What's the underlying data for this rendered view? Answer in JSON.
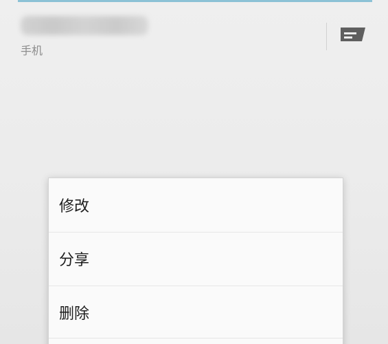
{
  "contact": {
    "number_hidden": true,
    "phone_type": "手机"
  },
  "actions": {
    "message_icon": "message-icon"
  },
  "context_menu": {
    "items": [
      {
        "label": "修改"
      },
      {
        "label": "分享"
      },
      {
        "label": "删除"
      }
    ]
  },
  "colors": {
    "accent_strip": "#8cc2d6",
    "icon": "#5f5f5f",
    "menu_text": "#1e1e1e",
    "secondary_text": "#8c8c8c"
  }
}
